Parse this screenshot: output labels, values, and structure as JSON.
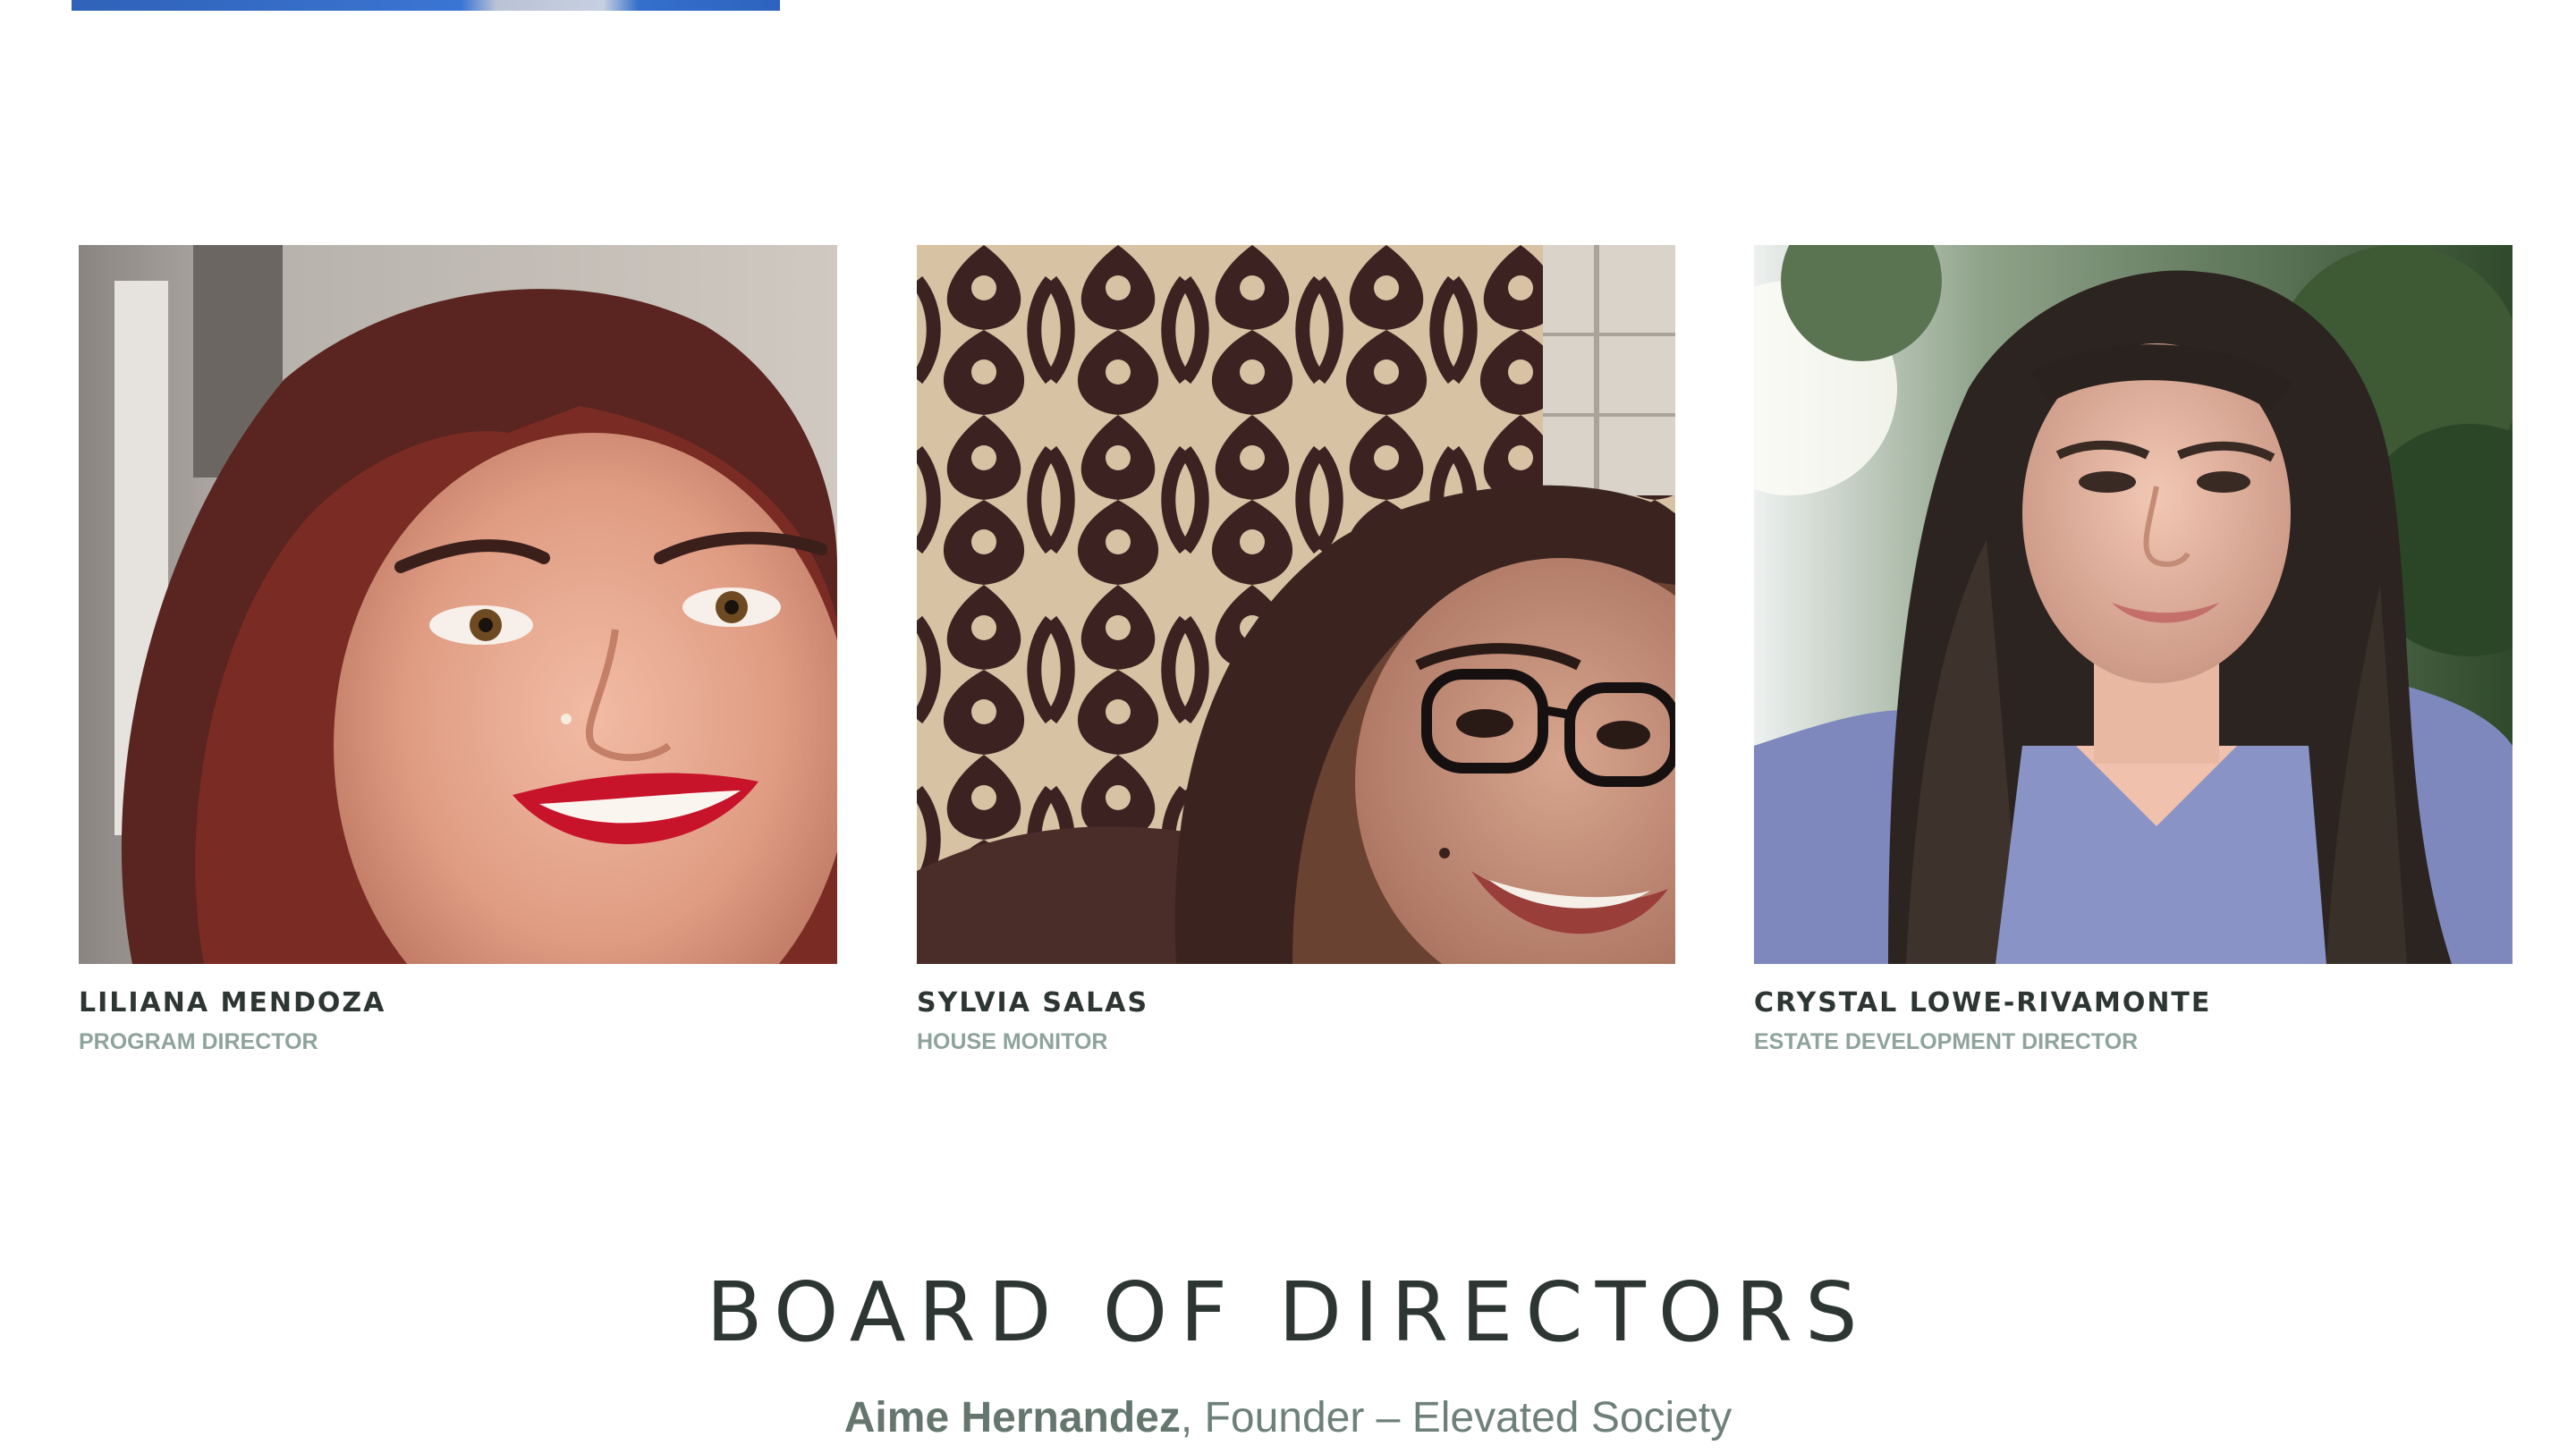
{
  "staff": [
    {
      "name": "LILIANA MENDOZA",
      "role": "PROGRAM DIRECTOR",
      "photo_alt": "Portrait of Liliana Mendoza"
    },
    {
      "name": "SYLVIA SALAS",
      "role": "HOUSE MONITOR",
      "photo_alt": "Portrait of Sylvia Salas"
    },
    {
      "name": "CRYSTAL LOWE-RIVAMONTE",
      "role": "ESTATE DEVELOPMENT DIRECTOR",
      "photo_alt": "Portrait of Crystal Lowe-Rivamonte"
    }
  ],
  "board": {
    "heading": "BOARD OF DIRECTORS",
    "members": [
      {
        "name": "Aime Hernandez",
        "title": ", Founder – Elevated Society"
      }
    ]
  },
  "colors": {
    "text_dark": "#2d3633",
    "role_text": "#8fa39c",
    "board_text": "#6f807b",
    "background": "#ffffff"
  }
}
